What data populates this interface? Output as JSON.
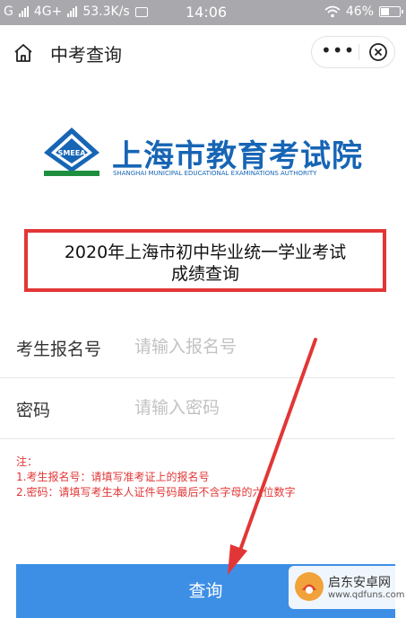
{
  "status_bar": {
    "network_type": "4G+",
    "net_speed": "53.3K/s",
    "time": "14:06",
    "battery": "46%",
    "battery_level": 0.46
  },
  "title_bar": {
    "title": "中考查询"
  },
  "logo": {
    "emblem_text": "SMEEA",
    "name_cn": "上海市教育考试院",
    "name_en": "SHANGHAI MUNICIPAL EDUCATIONAL EXAMINATIONS AUTHORITY"
  },
  "exam_title": {
    "line1": "2020年上海市初中毕业统一学业考试",
    "line2": "成绩查询"
  },
  "form": {
    "reg_label": "考生报名号",
    "reg_placeholder": "请输入报名号",
    "pwd_label": "密码",
    "pwd_placeholder": "请输入密码"
  },
  "notes": {
    "heading": "注：",
    "line1": "1.考生报名号：请填写准考证上的报名号",
    "line2": "2.密码：请填写考生本人证件号码最后不含字母的六位数字"
  },
  "submit_label": "查询",
  "watermark": {
    "name": "启东安卓网",
    "url": "www.qdfuns.com"
  },
  "colors": {
    "accent_blue": "#3d8fe6",
    "logo_blue": "#1765b5",
    "highlight_red": "#e23636"
  }
}
